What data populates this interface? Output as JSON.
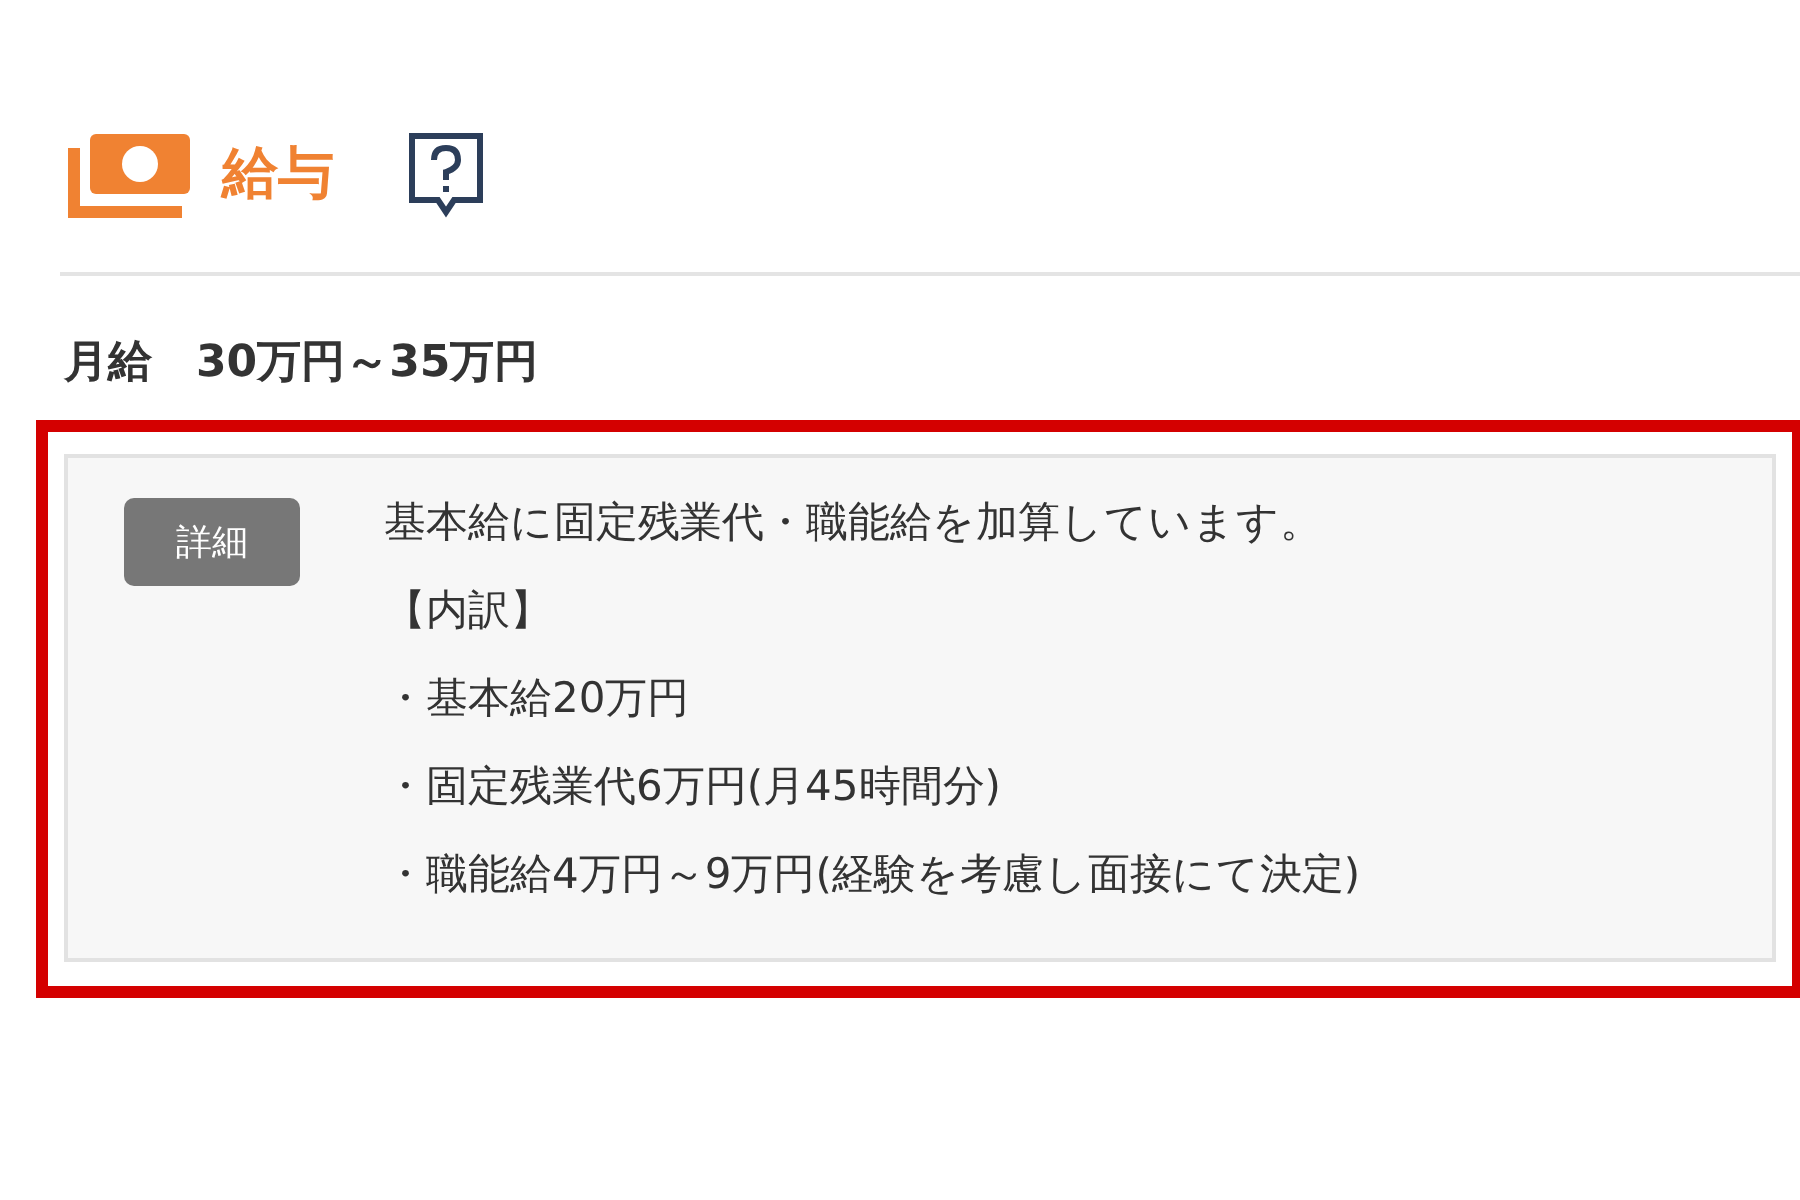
{
  "section": {
    "title": "給与"
  },
  "salary": {
    "label": "月給",
    "value": "30万円～35万円"
  },
  "details": {
    "badge": "詳細",
    "lines": [
      "基本給に固定残業代・職能給を加算しています。",
      "【内訳】",
      "・基本給20万円",
      "・固定残業代6万円(月45時間分)",
      "・職能給4万円～9万円(経験を考慮し面接にて決定)"
    ]
  }
}
